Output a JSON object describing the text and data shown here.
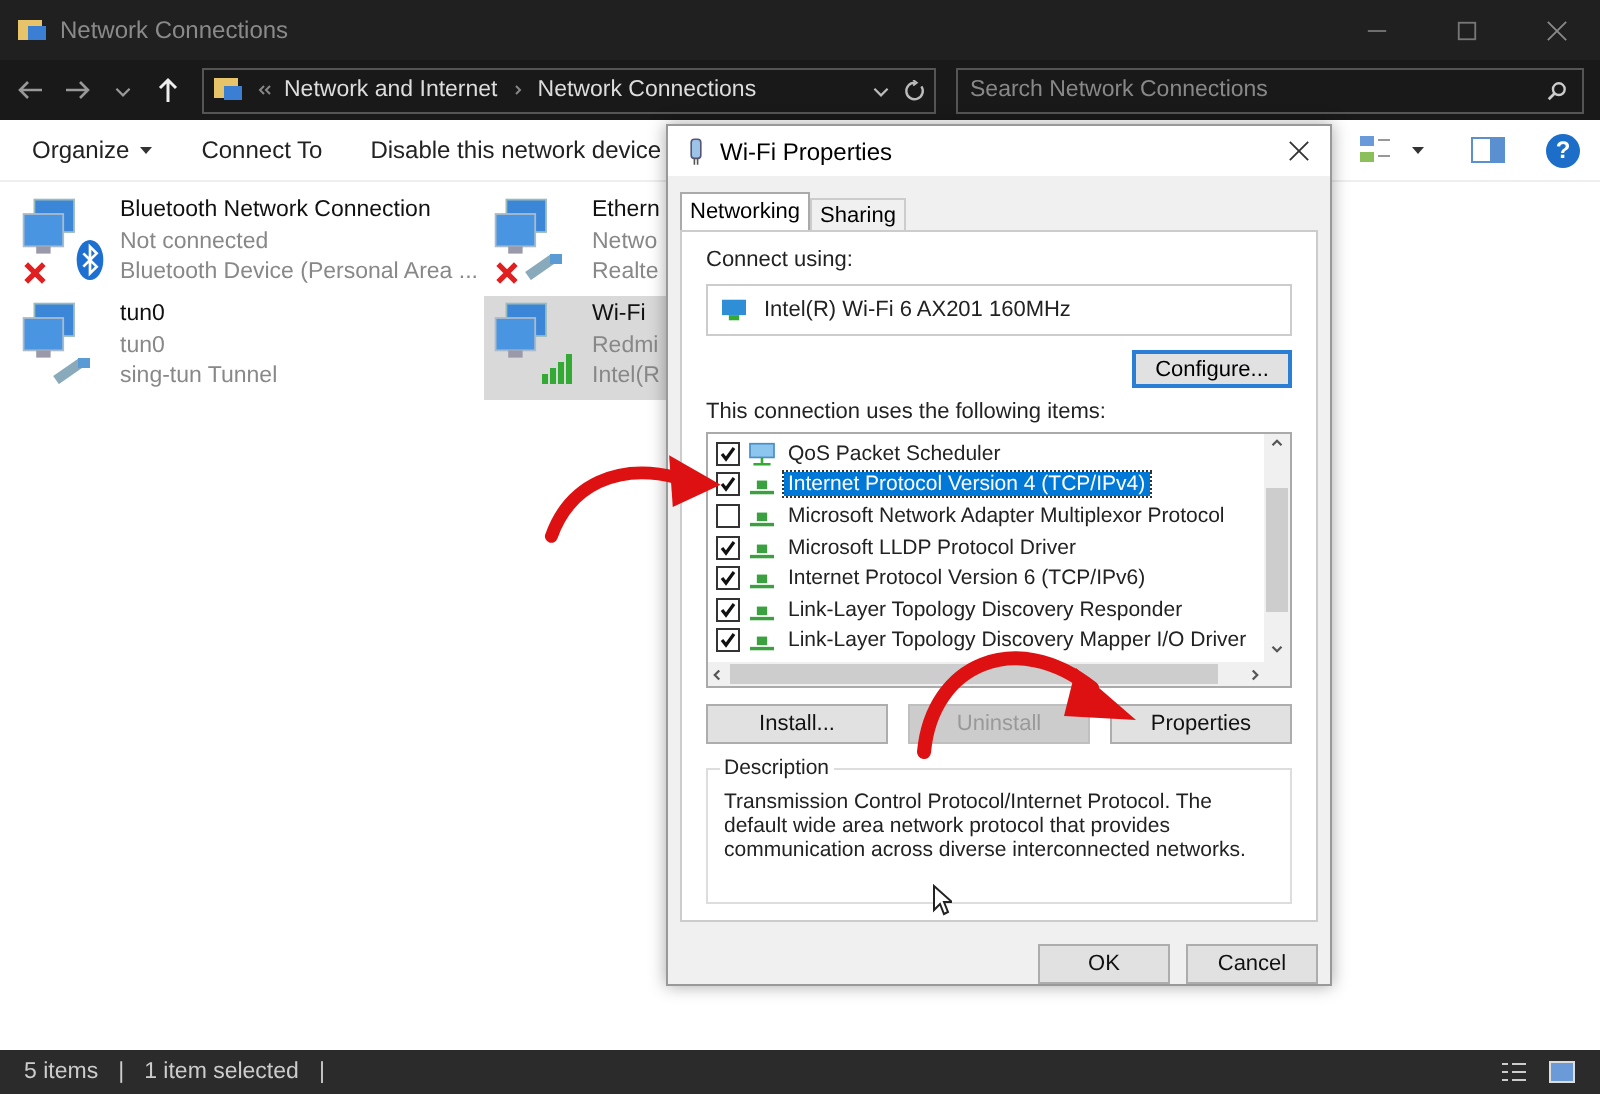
{
  "window": {
    "title": "Network Connections"
  },
  "address_bar": {
    "crumbs": [
      "Network and Internet",
      "Network Connections"
    ]
  },
  "search": {
    "placeholder": "Search Network Connections"
  },
  "command_bar": [
    "Organize",
    "Connect To",
    "Disable this network device"
  ],
  "help_button": "?",
  "connections": [
    {
      "name": "Bluetooth Network Connection",
      "status": "Not connected",
      "device": "Bluetooth Device (Personal Area ...",
      "kind": "bluetooth",
      "disconnected": true,
      "selected": false
    },
    {
      "name": "Ethern",
      "status": "Netwo",
      "device": "Realte",
      "kind": "ethernet",
      "disconnected": true,
      "selected": false
    },
    {
      "name": "tun0",
      "status": "tun0",
      "device": "sing-tun Tunnel",
      "kind": "ethernet",
      "disconnected": false,
      "selected": false
    },
    {
      "name": "Wi-Fi",
      "status": "Redmi",
      "device": "Intel(R",
      "kind": "wifi",
      "disconnected": false,
      "selected": true
    }
  ],
  "status_bar": [
    "5 items",
    "|",
    "1 item selected",
    "|"
  ],
  "dialog": {
    "title": "Wi-Fi Properties",
    "tabs": [
      {
        "label": "Networking",
        "selected": true
      },
      {
        "label": "Sharing",
        "selected": false
      }
    ],
    "connect_using_label": "Connect using:",
    "adapter": "Intel(R) Wi-Fi 6 AX201 160MHz",
    "configure_button": "Configure...",
    "items_label": "This connection uses the following items:",
    "items": [
      {
        "label": "QoS Packet Scheduler",
        "kind": "service",
        "checked": true,
        "selected": false
      },
      {
        "label": "Internet Protocol Version 4 (TCP/IPv4)",
        "kind": "protocol",
        "checked": true,
        "selected": true
      },
      {
        "label": "Microsoft Network Adapter Multiplexor Protocol",
        "kind": "protocol",
        "checked": false,
        "selected": false
      },
      {
        "label": "Microsoft LLDP Protocol Driver",
        "kind": "protocol",
        "checked": true,
        "selected": false
      },
      {
        "label": "Internet Protocol Version 6 (TCP/IPv6)",
        "kind": "protocol",
        "checked": true,
        "selected": false
      },
      {
        "label": "Link-Layer Topology Discovery Responder",
        "kind": "protocol",
        "checked": true,
        "selected": false
      },
      {
        "label": "Link-Layer Topology Discovery Mapper I/O Driver",
        "kind": "protocol",
        "checked": true,
        "selected": false
      }
    ],
    "buttons": [
      {
        "label": "Install...",
        "disabled": false
      },
      {
        "label": "Uninstall",
        "disabled": true
      },
      {
        "label": "Properties",
        "disabled": false
      }
    ],
    "description_label": "Description",
    "description": "Transmission Control Protocol/Internet Protocol. The default wide area network protocol that provides communication across diverse interconnected networks.",
    "footer_buttons": [
      "OK",
      "Cancel"
    ]
  }
}
